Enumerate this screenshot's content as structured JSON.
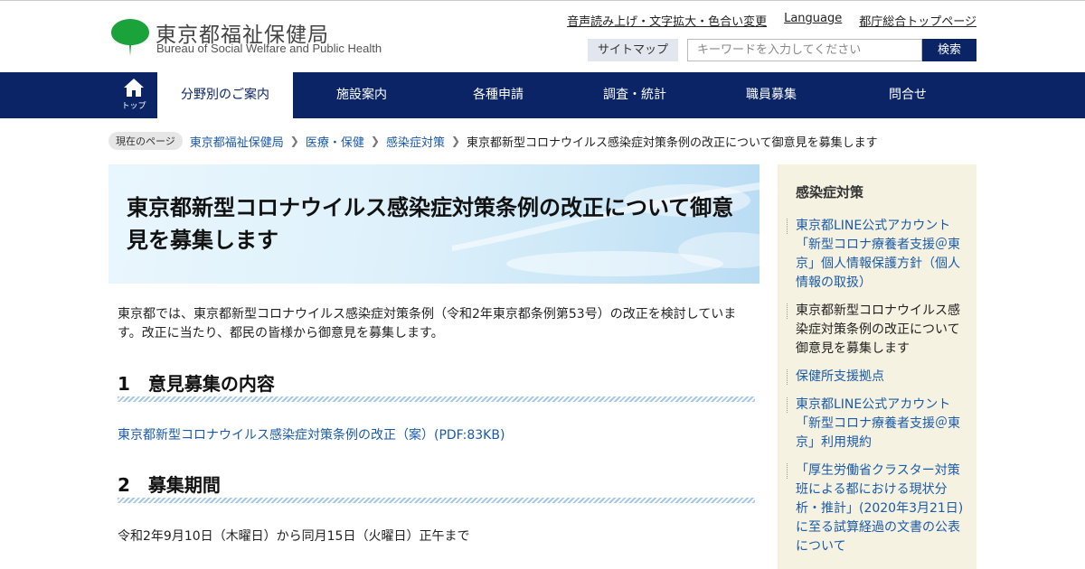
{
  "header": {
    "logo_ja": "東京都福祉保健局",
    "logo_en": "Bureau of Social Welfare and Public Health",
    "util_links": [
      "音声読み上げ・文字拡大・色合い変更",
      "Language",
      "都庁総合トップページ"
    ],
    "sitemap_label": "サイトマップ",
    "search_placeholder": "キーワードを入力してください",
    "search_button": "検索",
    "logo_color": "#1aa33a"
  },
  "gnav": {
    "home_label": "トップ",
    "items": [
      "分野別のご案内",
      "施設案内",
      "各種申請",
      "調査・統計",
      "職員募集",
      "問合せ"
    ],
    "active_index": 0,
    "bg_color": "#0a2466"
  },
  "breadcrumb": {
    "label": "現在のページ",
    "links": [
      "東京都福祉保健局",
      "医療・保健",
      "感染症対策"
    ],
    "current": "東京都新型コロナウイルス感染症対策条例の改正について御意見を募集します"
  },
  "main": {
    "title": "東京都新型コロナウイルス感染症対策条例の改正について御意見を募集します",
    "intro": "東京都では、東京都新型コロナウイルス感染症対策条例（令和2年東京都条例第53号）の改正を検討しています。改正に当たり、都民の皆様から御意見を募集します。",
    "section1_heading": "1　意見募集の内容",
    "section1_link": "東京都新型コロナウイルス感染症対策条例の改正（案）(PDF:83KB)",
    "section2_heading": "2　募集期間",
    "section2_text": "令和2年9月10日（木曜日）から同月15日（火曜日）正午まで"
  },
  "sidebar": {
    "title": "感染症対策",
    "items": [
      {
        "label": "東京都LINE公式アカウント「新型コロナ療養者支援＠東京」個人情報保護方針（個人情報の取扱）",
        "current": false
      },
      {
        "label": "東京都新型コロナウイルス感染症対策条例の改正について御意見を募集します",
        "current": true
      },
      {
        "label": "保健所支援拠点",
        "current": false
      },
      {
        "label": "東京都LINE公式アカウント「新型コロナ療養者支援＠東京」利用規約",
        "current": false
      },
      {
        "label": "「厚生労働省クラスター対策班による都における現状分析・推計」(2020年3月21日)に至る試算経過の文書の公表について",
        "current": false
      }
    ]
  }
}
